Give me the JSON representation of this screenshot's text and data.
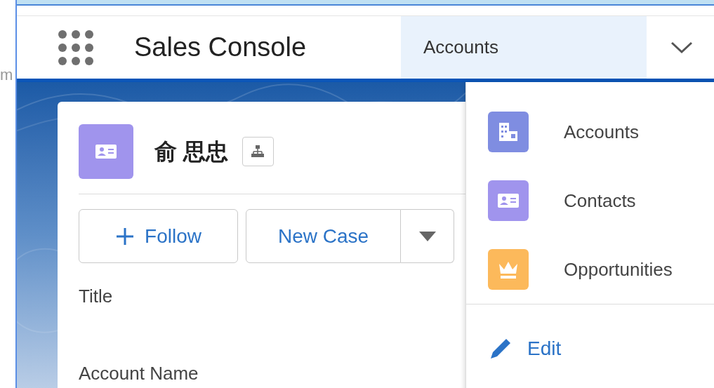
{
  "edge_text": "m",
  "app": {
    "name": "Sales Console"
  },
  "nav_tab": {
    "label": "Accounts",
    "selected": true
  },
  "record": {
    "name": "俞 思忠",
    "actions": [
      {
        "kind": "follow",
        "label": "Follow"
      },
      {
        "kind": "split",
        "label": "New Case"
      }
    ],
    "fields": [
      {
        "label": "Title"
      },
      {
        "label": "Account Name"
      }
    ]
  },
  "menu": {
    "items": [
      {
        "kind": "building",
        "label": "Accounts",
        "color": "#7f8de1"
      },
      {
        "kind": "contact",
        "label": "Contacts",
        "color": "#a094ed"
      },
      {
        "kind": "crown",
        "label": "Opportunities",
        "color": "#fcb95b"
      }
    ],
    "edit": "Edit"
  }
}
